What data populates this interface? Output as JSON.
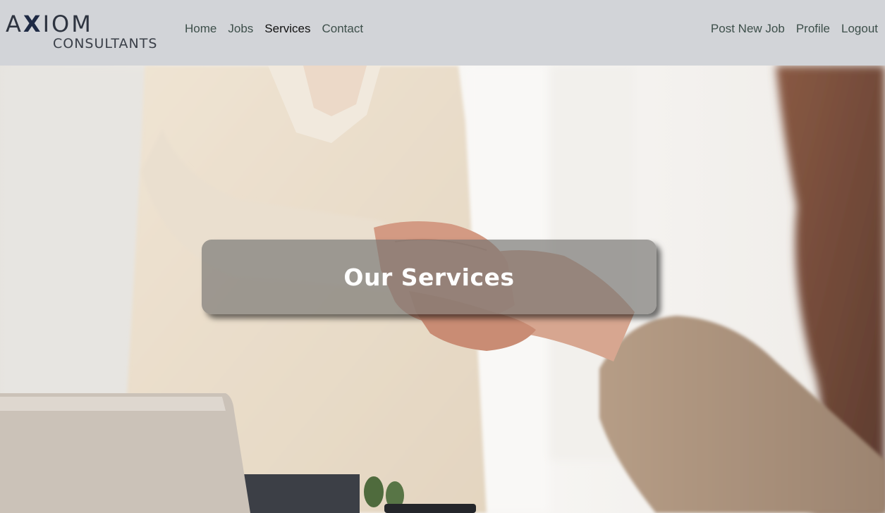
{
  "brand": {
    "line1": "AXIOM",
    "line2": "CONSULTANTS"
  },
  "nav": {
    "left": [
      {
        "label": "Home"
      },
      {
        "label": "Jobs"
      },
      {
        "label": "Services",
        "active": true
      },
      {
        "label": "Contact"
      }
    ],
    "right": [
      {
        "label": "Post New Job"
      },
      {
        "label": "Profile"
      },
      {
        "label": "Logout"
      }
    ]
  },
  "hero": {
    "title": "Our Services",
    "image": "handshake-photo"
  },
  "colors": {
    "navbar_bg": "#d2d4d8",
    "nav_link": "#3d4f4a",
    "nav_active": "#111111",
    "title_box": "#787673"
  }
}
